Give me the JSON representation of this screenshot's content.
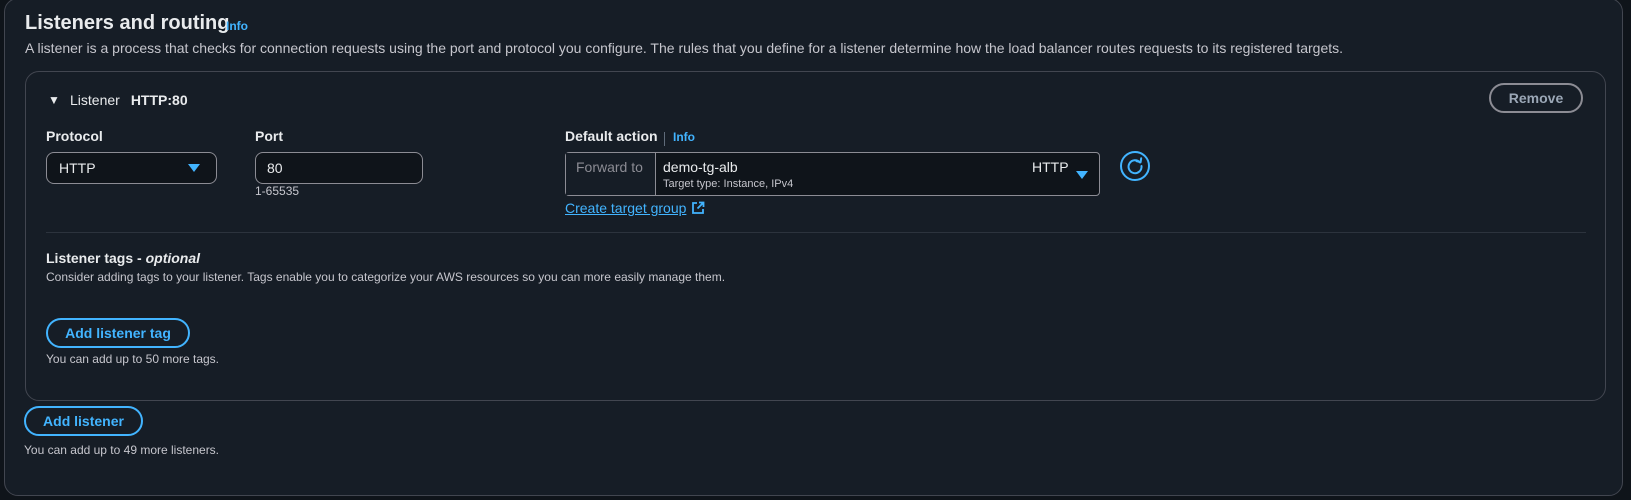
{
  "section": {
    "title": "Listeners and routing",
    "info": "Info",
    "description": "A listener is a process that checks for connection requests using the port and protocol you configure. The rules that you define for a listener determine how the load balancer routes requests to its registered targets."
  },
  "listener": {
    "label": "Listener",
    "id": "HTTP:80",
    "remove_label": "Remove",
    "protocol": {
      "label": "Protocol",
      "value": "HTTP"
    },
    "port": {
      "label": "Port",
      "value": "80",
      "hint": "1-65535"
    },
    "default_action": {
      "label": "Default action",
      "info": "Info",
      "forward_label": "Forward to",
      "target_group_name": "demo-tg-alb",
      "target_group_detail": "Target type: Instance, IPv4",
      "target_group_protocol": "HTTP",
      "create_link": "Create target group"
    },
    "tags": {
      "title": "Listener tags - ",
      "title_optional": "optional",
      "description": "Consider adding tags to your listener. Tags enable you to categorize your AWS resources so you can more easily manage them.",
      "add_label": "Add listener tag",
      "limit_hint": "You can add up to 50 more tags."
    }
  },
  "footer": {
    "add_listener_label": "Add listener",
    "limit_hint": "You can add up to 49 more listeners."
  },
  "colors": {
    "background": "#0f141a",
    "panel": "#161d26",
    "accent": "#42b4ff",
    "border": "#8c8c94"
  },
  "icons": {
    "expand": "triangle-down-icon",
    "select_caret": "caret-down-icon",
    "refresh": "refresh-icon",
    "external": "external-link-icon"
  }
}
